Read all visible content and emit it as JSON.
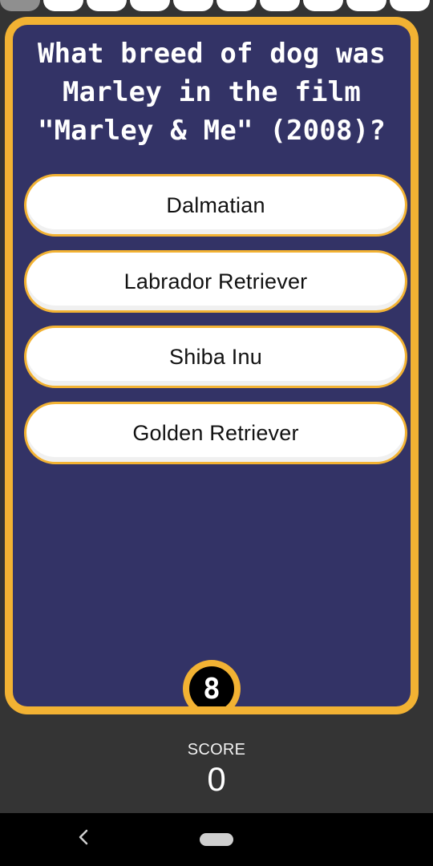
{
  "quiz": {
    "question": "What breed of dog was\nMarley in the film\n\"Marley & Me\" (2008)?",
    "answers": [
      "Dalmatian",
      "Labrador Retriever",
      "Shiba Inu",
      "Golden Retriever"
    ],
    "timer": "8"
  },
  "score": {
    "label": "SCORE",
    "value": "0"
  },
  "progress": {
    "current": 1,
    "total": 10
  },
  "icons": {
    "back": "back-icon",
    "home": "home-icon"
  },
  "colors": {
    "accent": "#f2b233",
    "panel": "#333366",
    "answer_bg": "#ffffff",
    "timer_bg": "#000000",
    "score_bg": "#343434"
  }
}
